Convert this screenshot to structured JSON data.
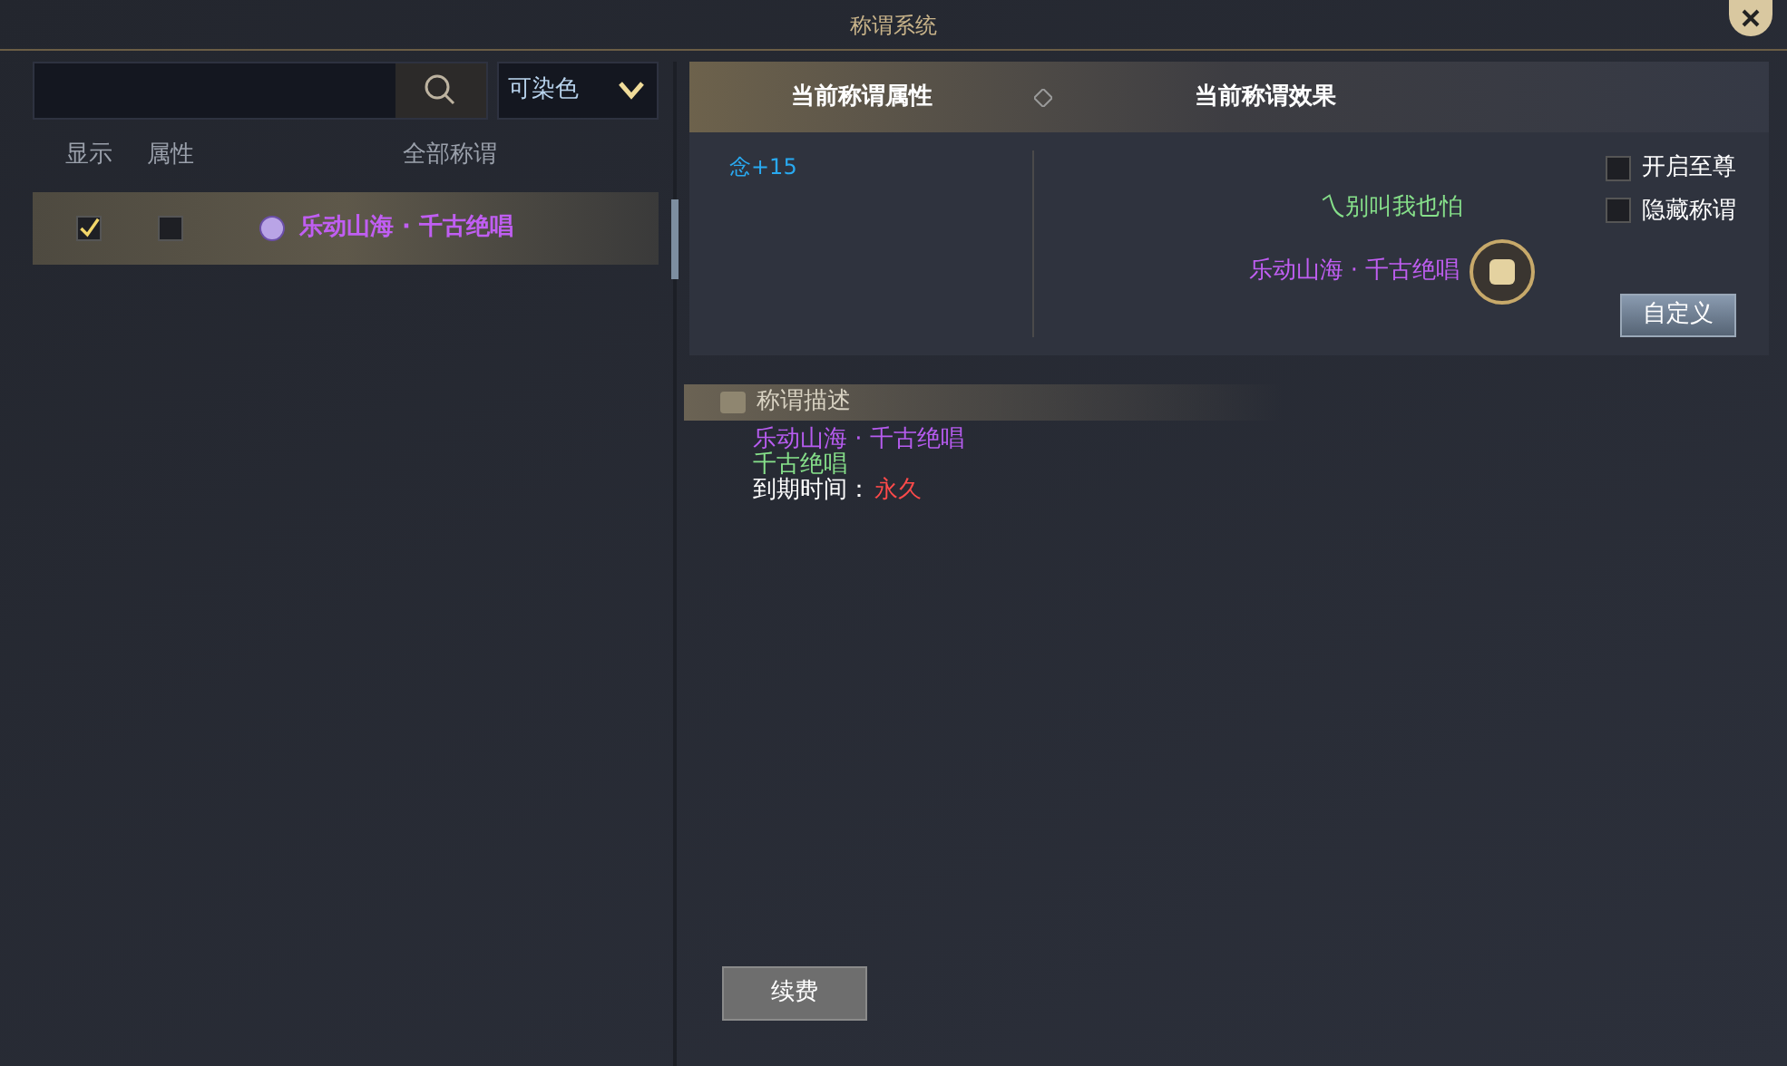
{
  "window": {
    "title": "称谓系统"
  },
  "filter": {
    "label": "可染色"
  },
  "list": {
    "columns": [
      "显示",
      "属性",
      "全部称谓"
    ],
    "rows": [
      {
        "show": true,
        "attribute": false,
        "name": "乐动山海 · 千古绝唱",
        "selected": true
      }
    ]
  },
  "tabs": [
    {
      "label": "当前称谓属性"
    },
    {
      "label": "当前称谓效果"
    }
  ],
  "attributes": [
    "念+15"
  ],
  "preview": {
    "nickname": "乀别叫我也怕",
    "title": "乐动山海 · 千古绝唱"
  },
  "options": [
    {
      "label": "开启至尊",
      "checked": false
    },
    {
      "label": "隐藏称谓",
      "checked": false
    }
  ],
  "customize_button": "自定义",
  "description": {
    "heading": "称谓描述",
    "name": "乐动山海 · 千古绝唱",
    "subtitle": "千古绝唱",
    "expiry_label": "到期时间：",
    "expiry_value": "永久"
  },
  "renew_button": "续费"
}
